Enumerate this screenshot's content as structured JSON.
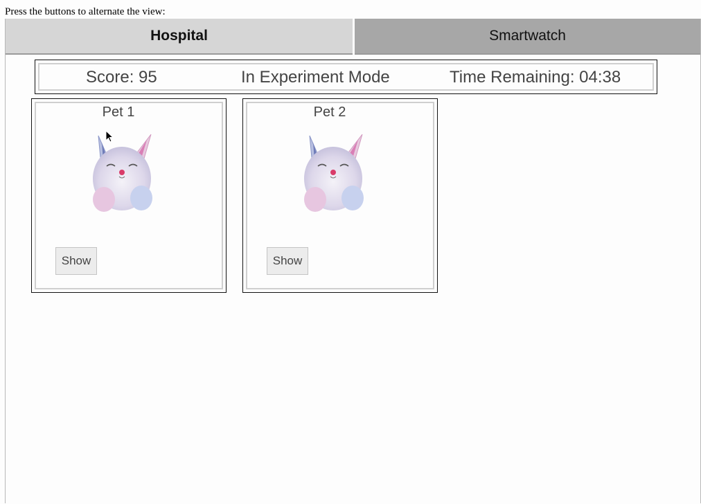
{
  "instruction": "Press the buttons to alternate the view:",
  "tabs": [
    {
      "label": "Hospital",
      "active": true
    },
    {
      "label": "Smartwatch",
      "active": false
    }
  ],
  "status": {
    "score": "Score: 95",
    "mode": "In Experiment Mode",
    "time": "Time Remaining: 04:38"
  },
  "pets": [
    {
      "name": "Pet 1",
      "button": "Show"
    },
    {
      "name": "Pet 2",
      "button": "Show"
    }
  ],
  "colors": {
    "tab_active": "#d6d6d6",
    "tab_inactive": "#a7a7a7",
    "text": "#444444"
  }
}
